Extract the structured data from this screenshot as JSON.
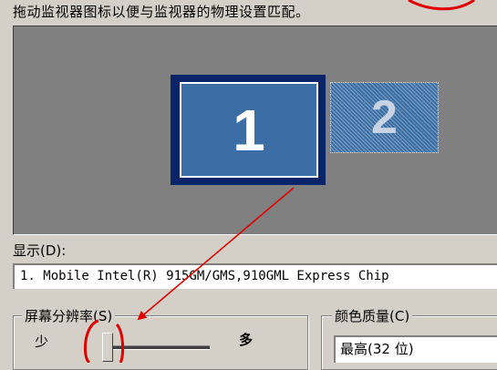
{
  "instruction": "拖动监视器图标以便与监视器的物理设置匹配。",
  "monitors": [
    {
      "number": "1",
      "selected": true
    },
    {
      "number": "2",
      "selected": false
    }
  ],
  "display": {
    "label": "显示(D):",
    "value": "1. Mobile Intel(R) 915GM/GMS,910GML Express Chip"
  },
  "resolution": {
    "group_label": "屏幕分辨率(S)",
    "min_label": "少",
    "max_label": "多"
  },
  "color_quality": {
    "group_label": "颜色质量(C)",
    "value": "最高(32 位)"
  },
  "colors": {
    "dialog_bg": "#d4d0c8",
    "monitor_selected": "#3a6ea5",
    "annotation": "#ff0000"
  }
}
